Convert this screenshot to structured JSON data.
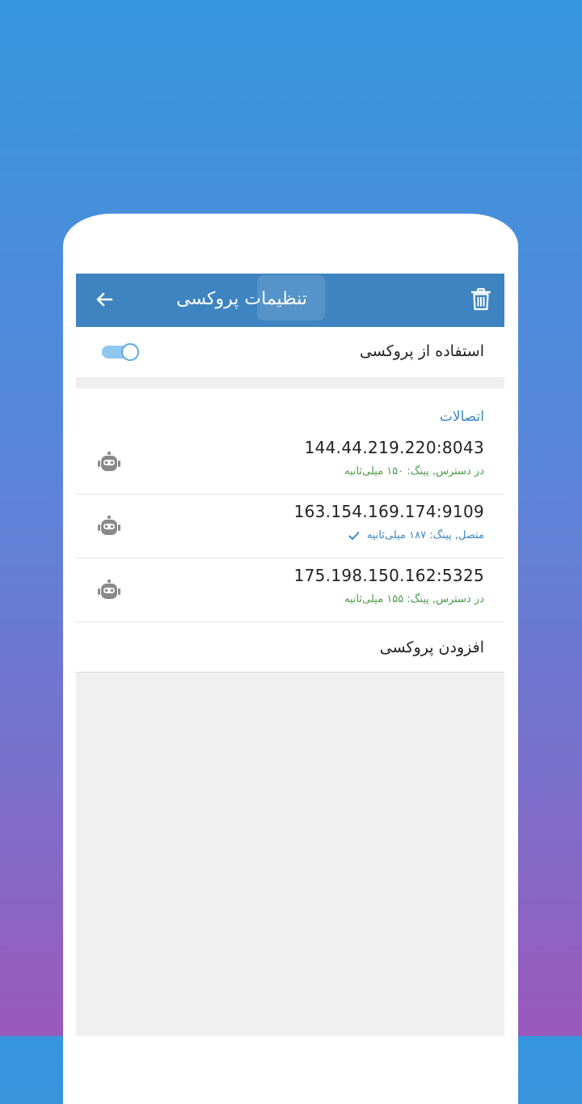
{
  "app_bar": {
    "title": "تنظیمات پروکسی",
    "back_icon": "arrow-left-icon",
    "delete_icon": "trash-icon",
    "color": "#3d84c0"
  },
  "use_proxy": {
    "label": "استفاده از پروکسی",
    "enabled": true
  },
  "connections": {
    "header": "اتصالات",
    "items": [
      {
        "address": "144.44.219.220:8043",
        "status": "در دسترس, پینگ: ۱۵۰ میلی‌ثانیه",
        "state": "available",
        "connected": false
      },
      {
        "address": "163.154.169.174:9109",
        "status": "متصل, پینگ: ۱۸۷ میلی‌ثانیه",
        "state": "connected",
        "connected": true
      },
      {
        "address": "175.198.150.162:5325",
        "status": "در دسترس, پینگ: ۱۵۵ میلی‌ثانیه",
        "state": "available",
        "connected": false
      }
    ]
  },
  "add_proxy": {
    "label": "افزودن پروکسی"
  },
  "colors": {
    "accent": "#3d86c3",
    "available": "#4a9d4a",
    "connected": "#3d86c3"
  }
}
